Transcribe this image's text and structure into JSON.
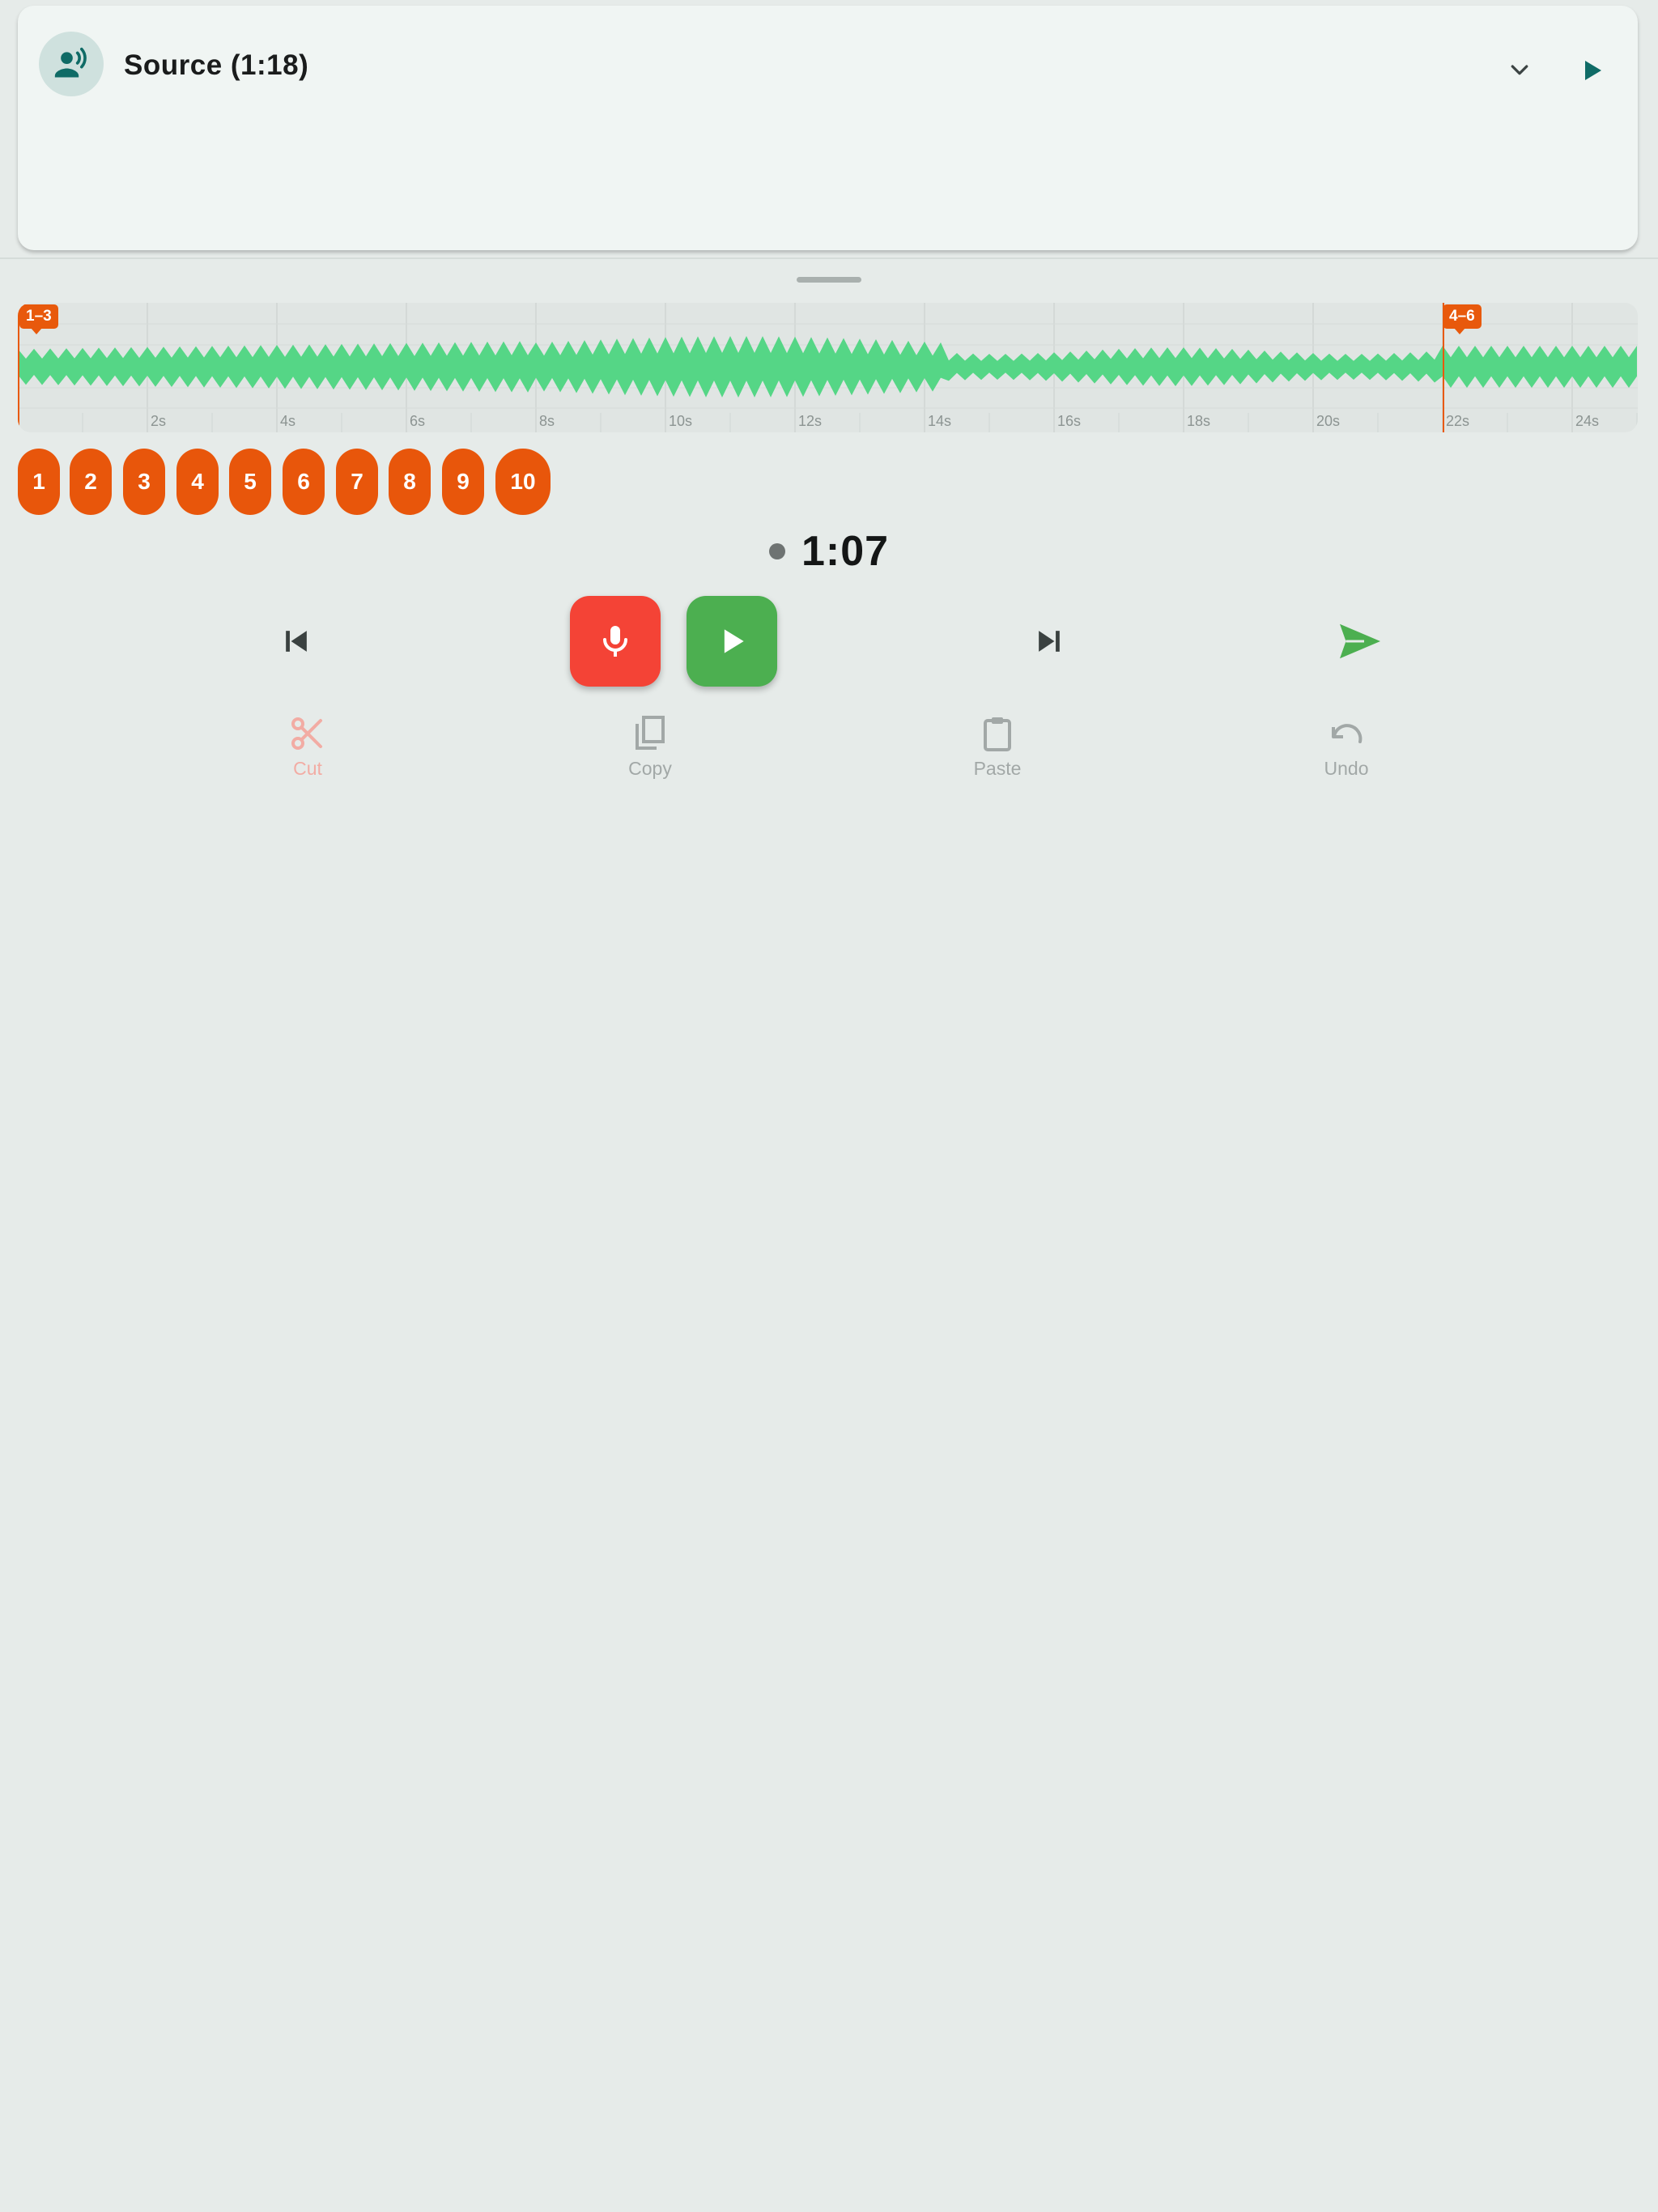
{
  "source": {
    "title": "Source (1:18)",
    "avatar_icon": "record-voice-icon",
    "expand_icon": "chevron-down-icon",
    "play_icon": "play-icon"
  },
  "waveform": {
    "color": "#55d686",
    "tick_labels": [
      "2s",
      "4s",
      "6s",
      "8s",
      "10s",
      "12s",
      "14s",
      "16s",
      "18s",
      "20s",
      "22s",
      "24s"
    ],
    "markers": [
      {
        "label": "1–3",
        "color": "#e8590c"
      },
      {
        "label": "4–6",
        "color": "#e8590c"
      }
    ]
  },
  "chips": [
    "1",
    "2",
    "3",
    "4",
    "5",
    "6",
    "7",
    "8",
    "9",
    "10"
  ],
  "chip_color": "#e8560b",
  "time": "1:07",
  "transport": {
    "skip_previous_icon": "skip-previous-icon",
    "record_icon": "microphone-icon",
    "play_icon": "play-icon",
    "skip_next_icon": "skip-next-icon",
    "send_icon": "send-icon",
    "record_color": "#f44336",
    "play_color": "#4caf50"
  },
  "edit_actions": [
    {
      "label": "Cut",
      "icon": "scissors-icon"
    },
    {
      "label": "Copy",
      "icon": "copy-icon"
    },
    {
      "label": "Paste",
      "icon": "paste-icon"
    },
    {
      "label": "Undo",
      "icon": "undo-icon"
    }
  ]
}
